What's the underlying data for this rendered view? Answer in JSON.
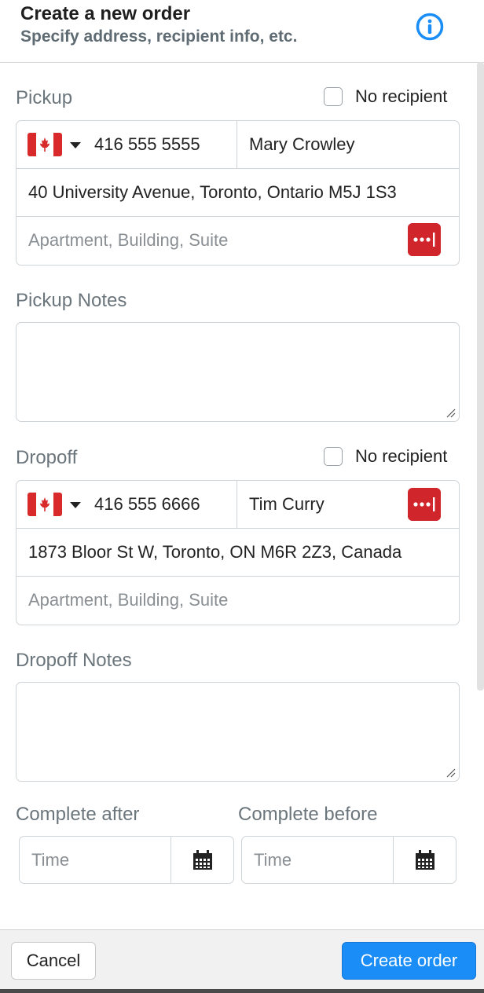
{
  "header": {
    "title": "Create a new order",
    "subtitle": "Specify address, recipient info, etc.",
    "icon": "info-icon"
  },
  "pickup": {
    "label": "Pickup",
    "no_recipient_label": "No recipient",
    "no_recipient_checked": false,
    "country_flag": "canada-flag-icon",
    "phone": "416 555 5555",
    "name": "Mary Crowley",
    "address": "40 University Avenue, Toronto, Ontario M5J 1S3",
    "apartment_placeholder": "Apartment, Building, Suite"
  },
  "pickup_notes": {
    "label": "Pickup Notes",
    "value": ""
  },
  "dropoff": {
    "label": "Dropoff",
    "no_recipient_label": "No recipient",
    "no_recipient_checked": false,
    "country_flag": "canada-flag-icon",
    "phone": "416 555 6666",
    "name": "Tim Curry",
    "address": "1873 Bloor St W, Toronto, ON M6R 2Z3, Canada",
    "apartment_placeholder": "Apartment, Building, Suite"
  },
  "dropoff_notes": {
    "label": "Dropoff Notes",
    "value": ""
  },
  "complete_after": {
    "label": "Complete after",
    "placeholder": "Time"
  },
  "complete_before": {
    "label": "Complete before",
    "placeholder": "Time"
  },
  "footer": {
    "cancel_label": "Cancel",
    "create_label": "Create order"
  },
  "colors": {
    "primary": "#1a8df7",
    "password_manager_red": "#d0252b",
    "label_gray": "#6b757c",
    "border": "#cfd4d8"
  }
}
